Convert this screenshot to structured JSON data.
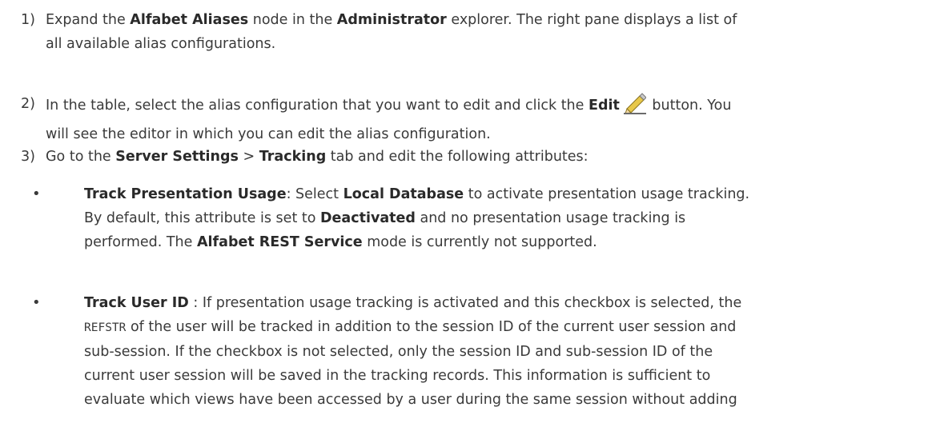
{
  "steps": [
    {
      "num": "1)",
      "t1": "Expand the ",
      "b1": "Alfabet Aliases",
      "t2": " node in the ",
      "b2": "Administrator",
      "t3": " explorer. The right pane displays a list of",
      "line2": "all available alias configurations."
    },
    {
      "num": "2)",
      "t1": "In the table, select the alias configuration that you want to edit and click the ",
      "b1": "Edit",
      "t2": " button. You",
      "line2": "will see the editor in which you can edit the alias configuration.",
      "icon": "pencil-edit-icon"
    },
    {
      "num": "3)",
      "t1": "Go to the ",
      "b1": "Server Settings",
      "t2": " > ",
      "b2": "Tracking",
      "t3": " tab and edit the following attributes:"
    }
  ],
  "bullets": [
    {
      "symbol": "•",
      "l1_b1": "Track Presentation Usage",
      "l1_t1": ": Select ",
      "l1_b2": "Local Database",
      "l1_t2": " to activate presentation usage tracking.",
      "l2_t1": "By default, this attribute is set to ",
      "l2_b1": "Deactivated",
      "l2_t2": " and no presentation usage tracking is",
      "l3": "performed. The ",
      "l3_b1": "Alfabet REST Service",
      "l3_t2": " mode is currently not supported."
    },
    {
      "symbol": "•",
      "l1_b1": "Track User ID",
      "l1_t1": " : If presentation usage tracking is activated and this checkbox is selected, the",
      "l2_code": "REFSTR",
      "l2_t1": " of the user will be tracked in addition to the session ID of the current user session and",
      "l3": "sub-session. If the checkbox is not selected, only the session ID and sub-session ID of the",
      "l4": "current user session will be saved in the tracking records. This information is sufficient to",
      "l5": "evaluate which views have been accessed by a user during the same session without adding"
    }
  ],
  "colors": {
    "text": "#3a3a3a",
    "pencil_body": "#e8c84a",
    "pencil_line": "#6b6b6b"
  }
}
